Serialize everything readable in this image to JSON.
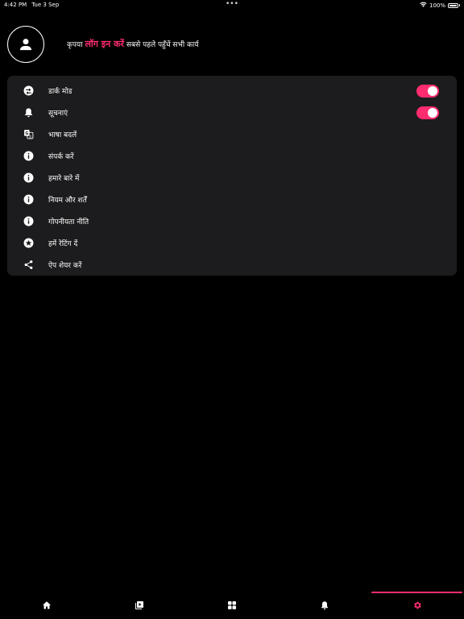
{
  "status_bar": {
    "time": "4:42 PM",
    "date": "Tue 3 Sep",
    "dots": "•••",
    "battery": "100%"
  },
  "profile": {
    "prefix": "कृपया ",
    "login_link": "लॉग इन करें",
    "suffix": " सबसे पहले पहुँचें सभी कार्य"
  },
  "settings": {
    "dark_mode": {
      "label": "डार्क मोड",
      "on": true
    },
    "notifications": {
      "label": "सूचनाएं",
      "on": true
    },
    "change_language": {
      "label": "भाषा बदलें"
    },
    "contact_us": {
      "label": "संपर्क करें"
    },
    "about_us": {
      "label": "हमारे बारे में"
    },
    "terms": {
      "label": "नियम और शर्तें"
    },
    "privacy": {
      "label": "गोपनीयता नीति"
    },
    "rate_us": {
      "label": "हमें रेटिंग दें"
    },
    "share_app": {
      "label": "ऐप शेयर करें"
    }
  },
  "tab_bar": {
    "active_tab": "settings",
    "tabs": [
      "home",
      "videos",
      "categories",
      "notifications",
      "settings"
    ]
  },
  "colors": {
    "accent": "#ff2d6f",
    "card": "#1c1c1e",
    "background": "#000000",
    "icon": "#ffffff",
    "inactive_tab_icon": "#ffffff"
  }
}
